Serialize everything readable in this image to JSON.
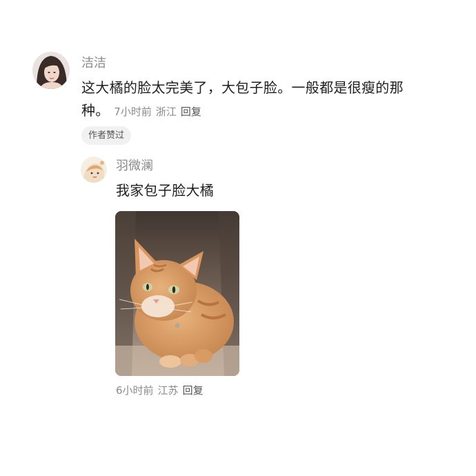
{
  "comment": {
    "username": "洁洁",
    "text": "这大橘的脸太完美了，大包子脸。一般都是很瘦的那种。",
    "time": "7小时前",
    "location": "浙江",
    "reply_label": "回复",
    "badge": "作者赞过",
    "avatar_icon": "user-avatar-photo"
  },
  "reply": {
    "username": "羽微澜",
    "text": "我家包子脸大橘",
    "time": "6小时前",
    "location": "江苏",
    "reply_label": "回复",
    "avatar_icon": "user-avatar-illustration",
    "photo_subject": "orange-tabby-cat-in-box"
  },
  "colors": {
    "text_primary": "#1f1f1f",
    "text_secondary": "#8a8a8a",
    "badge_bg": "#f1f1f1",
    "cat_orange": "#d79a63"
  }
}
